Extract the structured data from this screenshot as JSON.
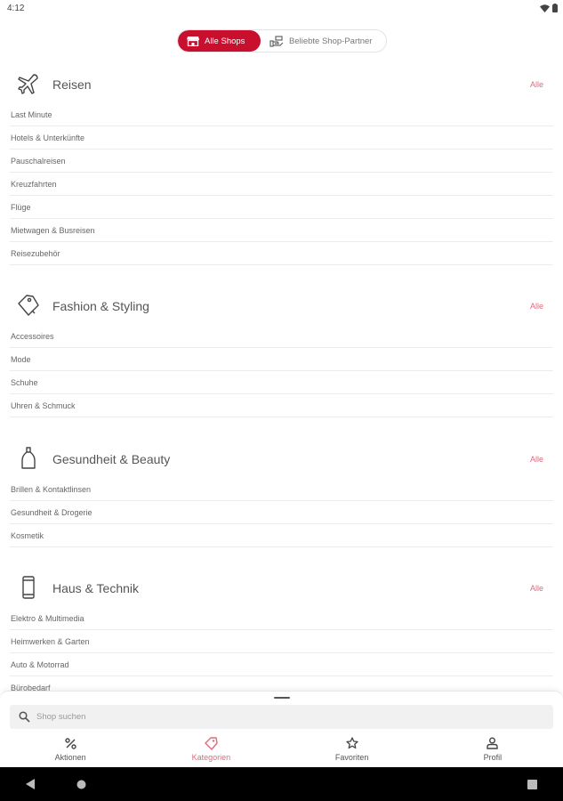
{
  "status": {
    "time": "4:12"
  },
  "toggle": {
    "all_shops": "Alle Shops",
    "popular_partners": "Beliebte Shop-Partner"
  },
  "accent_color": "#c8102e",
  "sections": [
    {
      "icon": "airplane-icon",
      "title": "Reisen",
      "all_label": "Alle",
      "items": [
        "Last Minute",
        "Hotels & Unterkünfte",
        "Pauschalreisen",
        "Kreuzfahrten",
        "Flüge",
        "Mietwagen & Busreisen",
        "Reisezubehör"
      ]
    },
    {
      "icon": "price-tag-icon",
      "title": "Fashion & Styling",
      "all_label": "Alle",
      "items": [
        "Accessoires",
        "Mode",
        "Schuhe",
        "Uhren & Schmuck"
      ]
    },
    {
      "icon": "bottle-icon",
      "title": "Gesundheit & Beauty",
      "all_label": "Alle",
      "items": [
        "Brillen & Kontaktlinsen",
        "Gesundheit & Drogerie",
        "Kosmetik"
      ]
    },
    {
      "icon": "smartphone-icon",
      "title": "Haus & Technik",
      "all_label": "Alle",
      "items": [
        "Elektro & Multimedia",
        "Heimwerken & Garten",
        "Auto & Motorrad",
        "Bürobedarf"
      ]
    }
  ],
  "search": {
    "placeholder": "Shop suchen"
  },
  "tabs": [
    {
      "label": "Aktionen",
      "icon": "percent-icon"
    },
    {
      "label": "Kategorien",
      "icon": "tag-icon",
      "active": true
    },
    {
      "label": "Favoriten",
      "icon": "star-icon"
    },
    {
      "label": "Profil",
      "icon": "person-icon"
    }
  ]
}
